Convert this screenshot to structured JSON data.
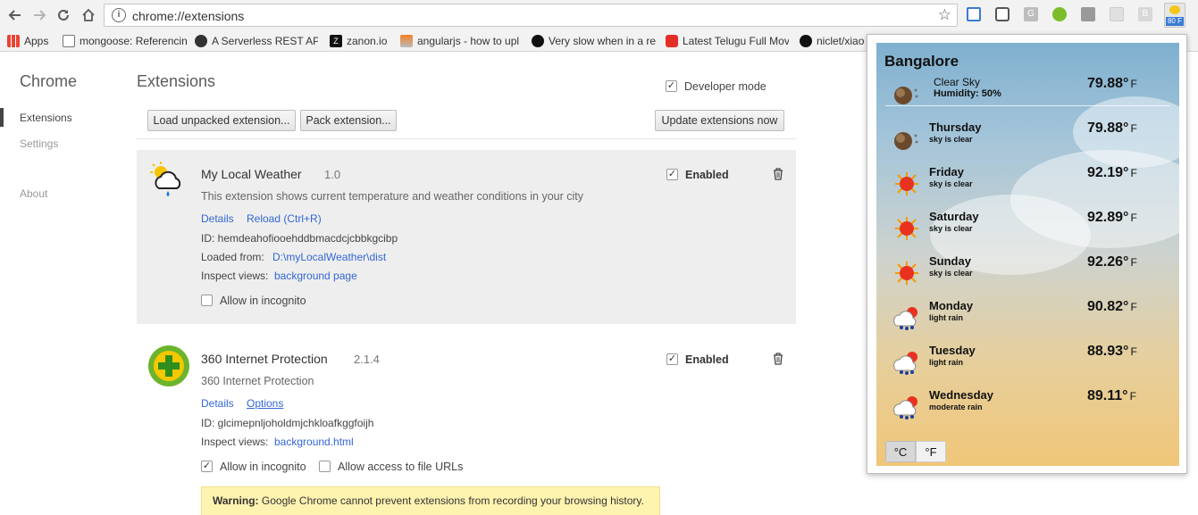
{
  "browser": {
    "url": "chrome://extensions",
    "badge": "80 F"
  },
  "bookmarks": [
    {
      "label": "Apps"
    },
    {
      "label": "mongoose: Referencin"
    },
    {
      "label": "A Serverless REST API"
    },
    {
      "label": "zanon.io"
    },
    {
      "label": "angularjs - how to upl"
    },
    {
      "label": "Very slow when in a re"
    },
    {
      "label": "Latest Telugu Full Mov"
    },
    {
      "label": "niclet/xiao"
    }
  ],
  "sidebar": {
    "title": "Chrome",
    "items": [
      {
        "label": "Extensions"
      },
      {
        "label": "Settings"
      },
      {
        "label": "About"
      }
    ]
  },
  "main": {
    "title": "Extensions",
    "developer_mode_label": "Developer mode",
    "load_unpacked_label": "Load unpacked extension...",
    "pack_label": "Pack extension...",
    "update_label": "Update extensions now"
  },
  "extensions": [
    {
      "name": "My Local Weather",
      "version": "1.0",
      "description": "This extension shows current temperature and weather conditions in your city",
      "details_label": "Details",
      "reload_label": "Reload (Ctrl+R)",
      "id_line": "ID: hemdeahofiooehddbmacdcjcbbkgcibp",
      "loaded_from_label": "Loaded from:",
      "loaded_from_path": "D:\\myLocalWeather\\dist",
      "inspect_label": "Inspect views:",
      "inspect_link": "background page",
      "incognito_label": "Allow in incognito",
      "enabled_label": "Enabled"
    },
    {
      "name": "360 Internet Protection",
      "version": "2.1.4",
      "description": "360 Internet Protection",
      "details_label": "Details",
      "options_label": "Options",
      "id_line": "ID: glcimepnljoholdmjchkloafkggfoijh",
      "inspect_label": "Inspect views:",
      "inspect_link": "background.html",
      "incognito_label": "Allow in incognito",
      "file_urls_label": "Allow access to file URLs",
      "enabled_label": "Enabled",
      "warning_bold": "Warning:",
      "warning_text": " Google Chrome cannot prevent extensions from recording your browsing history."
    }
  ],
  "weather": {
    "city": "Bangalore",
    "current": {
      "condition": "Clear Sky",
      "humidity": "Humidity: 50%",
      "temp": "79.88°",
      "unit": "F"
    },
    "forecast": [
      {
        "day": "Thursday",
        "condition": "sky is clear",
        "temp": "79.88°",
        "unit": "F",
        "icon": "moon-icon"
      },
      {
        "day": "Friday",
        "condition": "sky is clear",
        "temp": "92.19°",
        "unit": "F",
        "icon": "sun-icon"
      },
      {
        "day": "Saturday",
        "condition": "sky is clear",
        "temp": "92.89°",
        "unit": "F",
        "icon": "sun-icon"
      },
      {
        "day": "Sunday",
        "condition": "sky is clear",
        "temp": "92.26°",
        "unit": "F",
        "icon": "sun-icon"
      },
      {
        "day": "Monday",
        "condition": "light rain",
        "temp": "90.82°",
        "unit": "F",
        "icon": "rain-icon"
      },
      {
        "day": "Tuesday",
        "condition": "light rain",
        "temp": "88.93°",
        "unit": "F",
        "icon": "rain-icon"
      },
      {
        "day": "Wednesday",
        "condition": "moderate rain",
        "temp": "89.11°",
        "unit": "F",
        "icon": "rain-icon"
      }
    ],
    "unit_c": "°C",
    "unit_f": "°F"
  }
}
